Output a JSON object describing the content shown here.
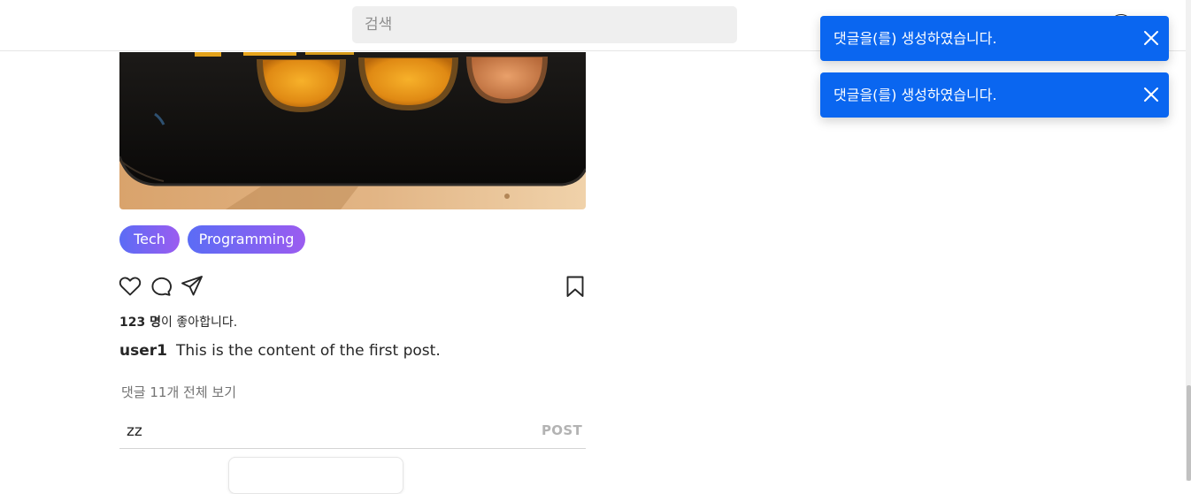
{
  "header": {
    "search_placeholder": "검색"
  },
  "post": {
    "tags": [
      "Tech",
      "Programming"
    ],
    "likes_count": "123 명",
    "likes_suffix": "이 좋아합니다.",
    "author": "user1",
    "content": "This is the content of the first post.",
    "view_comments_label": "댓글 11개 전체 보기",
    "comment_input_value": "zz",
    "post_button_label": "POST",
    "image_subject": "roasted sweet pumpkin slices on a black baking tray"
  },
  "toasts": [
    {
      "message": "댓글을(를) 생성하였습니다."
    },
    {
      "message": "댓글을(를) 생성하였습니다."
    }
  ],
  "icons": {
    "like": "heart-icon",
    "comment": "speech-bubble-icon",
    "share": "paper-plane-icon",
    "save": "bookmark-icon",
    "toast_close": "close-icon"
  },
  "colors": {
    "toast_background": "#0a66f0",
    "tag_gradient_start": "#5b6cf5",
    "tag_gradient_end": "#9b5cf0",
    "search_background": "#efefef",
    "post_button_disabled": "#b3b3b3"
  }
}
